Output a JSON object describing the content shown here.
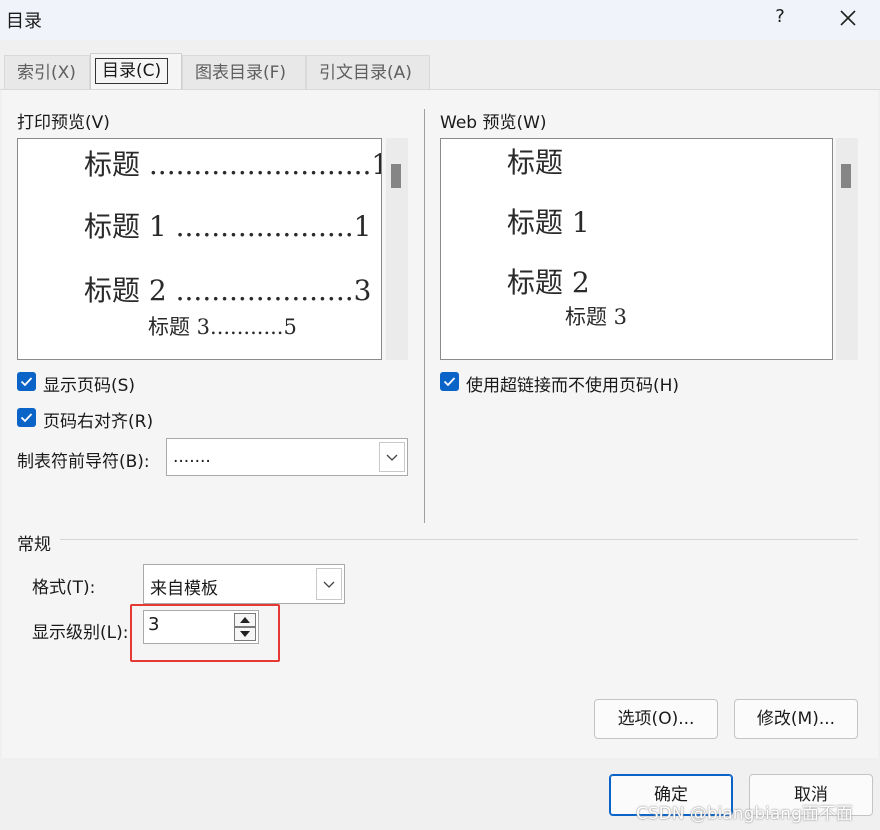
{
  "window": {
    "title": "目录",
    "help_label": "?",
    "close_icon": "close-icon"
  },
  "tabs": [
    {
      "label": "索引(X)",
      "active": false
    },
    {
      "label": "目录(C)",
      "active": true
    },
    {
      "label": "图表目录(F)",
      "active": false
    },
    {
      "label": "引文目录(A)",
      "active": false
    }
  ],
  "print_preview": {
    "label": "打印预览(V)",
    "lines": [
      {
        "text": "标题 .........................1"
      },
      {
        "text": "标题 1 ....................1"
      },
      {
        "text": "标题 2 ....................3"
      },
      {
        "text": "标题 3...........5"
      }
    ]
  },
  "web_preview": {
    "label": "Web 预览(W)",
    "lines": [
      {
        "text": "标题"
      },
      {
        "text": "标题 1"
      },
      {
        "text": "标题 2"
      },
      {
        "text": "标题 3"
      }
    ]
  },
  "options": {
    "show_page_numbers": {
      "label": "显示页码(S)",
      "checked": true
    },
    "right_align": {
      "label": "页码右对齐(R)",
      "checked": true
    },
    "use_hyperlinks": {
      "label": "使用超链接而不使用页码(H)",
      "checked": true
    },
    "tab_leader": {
      "label": "制表符前导符(B):",
      "value": "......."
    }
  },
  "general": {
    "label": "常规",
    "format_label": "格式(T):",
    "format_value": "来自模板",
    "levels_label": "显示级别(L):",
    "levels_value": "3"
  },
  "buttons": {
    "options": "选项(O)...",
    "modify": "修改(M)...",
    "ok": "确定",
    "cancel": "取消"
  },
  "watermark": "CSDN @biangbiang面不面",
  "colors": {
    "accent": "#0a64c8",
    "highlight_box": "#e53935"
  }
}
